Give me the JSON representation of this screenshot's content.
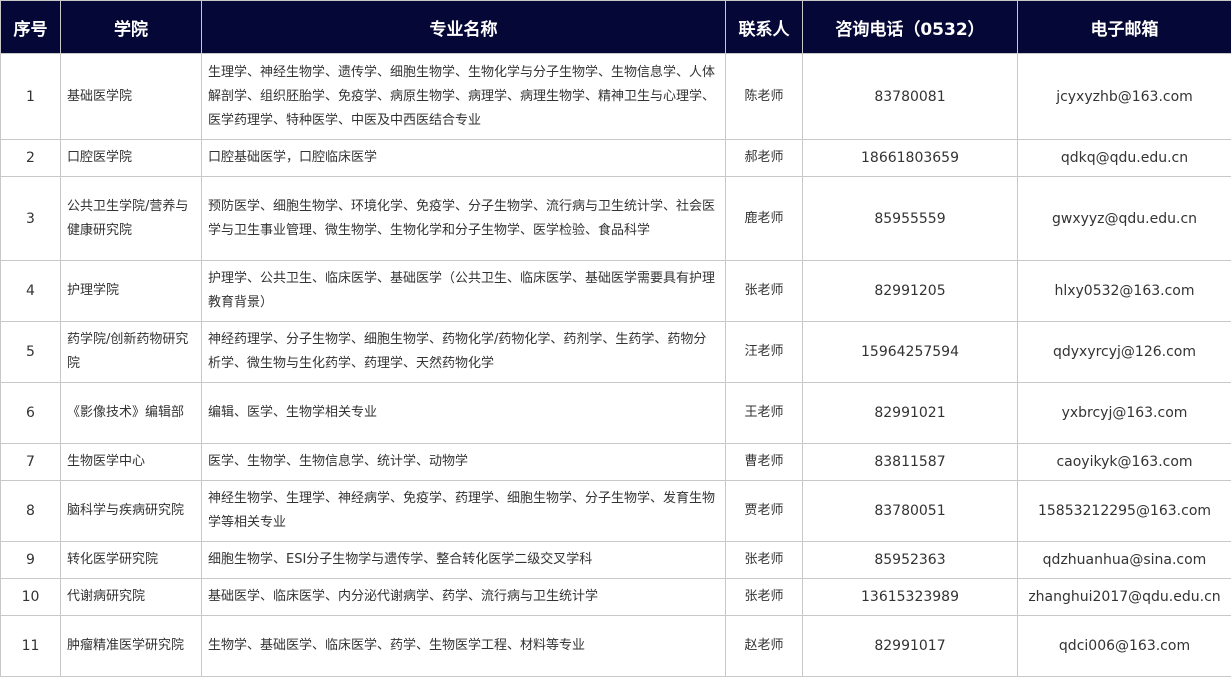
{
  "header": {
    "index": "序号",
    "college": "学院",
    "major": "专业名称",
    "contact": "联系人",
    "phone": "咨询电话（0532）",
    "email": "电子邮箱"
  },
  "rows": [
    {
      "index": "1",
      "college": "基础医学院",
      "major": "生理学、神经生物学、遗传学、细胞生物学、生物化学与分子生物学、生物信息学、人体解剖学、组织胚胎学、免疫学、病原生物学、病理学、病理生物学、精神卫生与心理学、医学药理学、特种医学、中医及中西医结合专业",
      "contact": "陈老师",
      "phone": "83780081",
      "email": "jcyxyzhb@163.com"
    },
    {
      "index": "2",
      "college": "口腔医学院",
      "major": "口腔基础医学，口腔临床医学",
      "contact": "郝老师",
      "phone": "18661803659",
      "email": "qdkq@qdu.edu.cn"
    },
    {
      "index": "3",
      "college": "公共卫生学院/营养与健康研究院",
      "major": "预防医学、细胞生物学、环境化学、免疫学、分子生物学、流行病与卫生统计学、社会医学与卫生事业管理、微生物学、生物化学和分子生物学、医学检验、食品科学",
      "contact": "鹿老师",
      "phone": "85955559",
      "email": "gwxyyz@qdu.edu.cn"
    },
    {
      "index": "4",
      "college": "护理学院",
      "major": "护理学、公共卫生、临床医学、基础医学（公共卫生、临床医学、基础医学需要具有护理教育背景）",
      "contact": "张老师",
      "phone": "82991205",
      "email": "hlxy0532@163.com"
    },
    {
      "index": "5",
      "college": "药学院/创新药物研究院",
      "major": "神经药理学、分子生物学、细胞生物学、药物化学/药物化学、药剂学、生药学、药物分析学、微生物与生化药学、药理学、天然药物化学",
      "contact": "汪老师",
      "phone": "15964257594",
      "email": "qdyxyrcyj@126.com"
    },
    {
      "index": "6",
      "college": "《影像技术》编辑部",
      "major": "编辑、医学、生物学相关专业",
      "contact": "王老师",
      "phone": "82991021",
      "email": "yxbrcyj@163.com"
    },
    {
      "index": "7",
      "college": "生物医学中心",
      "major": "医学、生物学、生物信息学、统计学、动物学",
      "contact": "曹老师",
      "phone": "83811587",
      "email": "caoyikyk@163.com"
    },
    {
      "index": "8",
      "college": "脑科学与疾病研究院",
      "major": "神经生物学、生理学、神经病学、免疫学、药理学、细胞生物学、分子生物学、发育生物学等相关专业",
      "contact": "贾老师",
      "phone": "83780051",
      "email": "15853212295@163.com"
    },
    {
      "index": "9",
      "college": "转化医学研究院",
      "major": "细胞生物学、ESI分子生物学与遗传学、整合转化医学二级交叉学科",
      "contact": "张老师",
      "phone": "85952363",
      "email": "qdzhuanhua@sina.com"
    },
    {
      "index": "10",
      "college": "代谢病研究院",
      "major": "基础医学、临床医学、内分泌代谢病学、药学、流行病与卫生统计学",
      "contact": "张老师",
      "phone": "13615323989",
      "email": "zhanghui2017@qdu.edu.cn"
    },
    {
      "index": "11",
      "college": "肿瘤精准医学研究院",
      "major": "生物学、基础医学、临床医学、药学、生物医学工程、材料等专业",
      "contact": "赵老师",
      "phone": "82991017",
      "email": "qdci006@163.com"
    }
  ]
}
